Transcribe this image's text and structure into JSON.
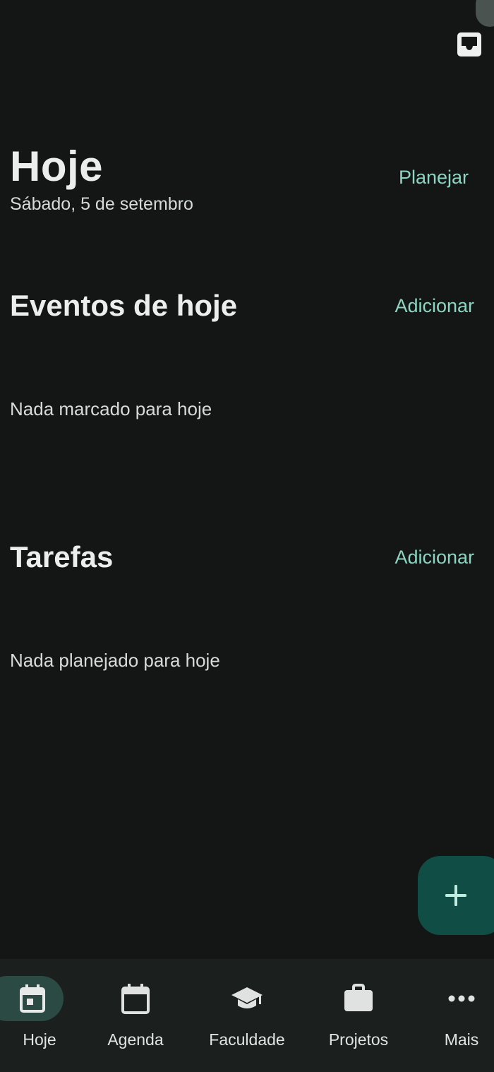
{
  "header": {
    "title": "Hoje",
    "date": "Sábado, 5 de setembro",
    "plan_label": "Planejar",
    "inbox_icon": "inbox-icon"
  },
  "events": {
    "title": "Eventos de hoje",
    "add_label": "Adicionar",
    "empty_text": "Nada marcado para hoje"
  },
  "tasks": {
    "title": "Tarefas",
    "add_label": "Adicionar",
    "empty_text": "Nada planejado para hoje"
  },
  "fab": {
    "icon": "plus-icon"
  },
  "bottom_nav": {
    "items": [
      {
        "label": "Hoje",
        "icon": "calendar-today-icon",
        "active": true
      },
      {
        "label": "Agenda",
        "icon": "calendar-icon",
        "active": false
      },
      {
        "label": "Faculdade",
        "icon": "graduation-cap-icon",
        "active": false
      },
      {
        "label": "Projetos",
        "icon": "briefcase-icon",
        "active": false
      },
      {
        "label": "Mais",
        "icon": "more-horizontal-icon",
        "active": false
      }
    ]
  },
  "colors": {
    "background": "#131615",
    "accent": "#8cd5c0",
    "fab": "#0f4d45",
    "nav_background": "#1b201e",
    "nav_active_pill": "#2c4a44"
  }
}
